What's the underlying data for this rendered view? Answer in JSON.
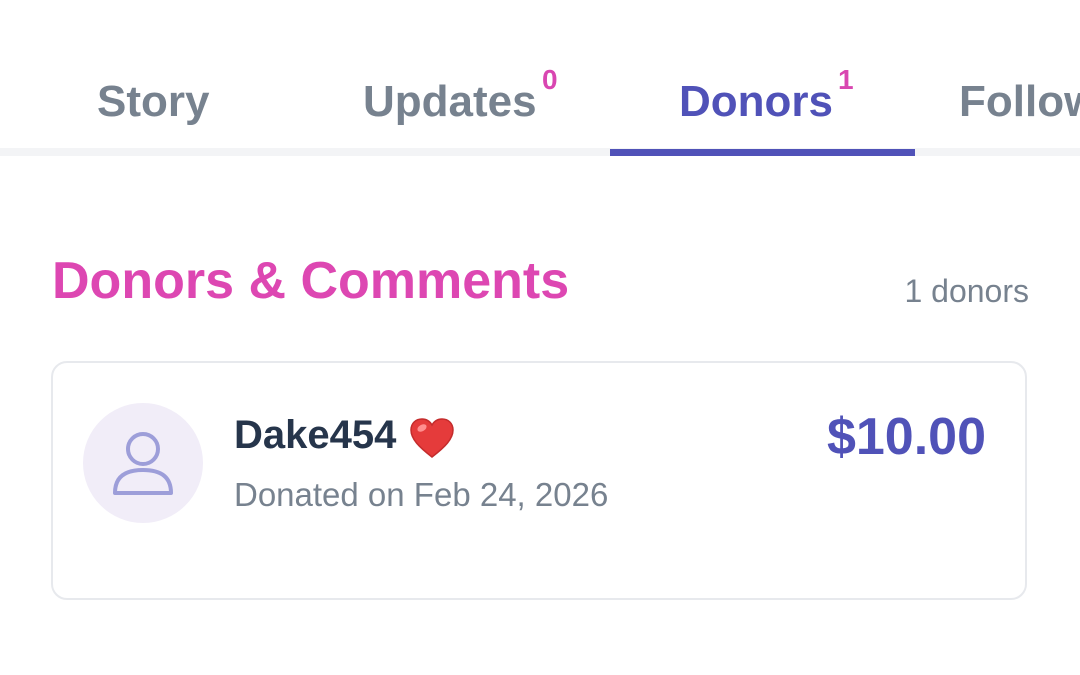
{
  "tabs": [
    {
      "label": "Story",
      "count": "",
      "active": false
    },
    {
      "label": "Updates",
      "count": "0",
      "active": false
    },
    {
      "label": "Donors",
      "count": "1",
      "active": true
    },
    {
      "label": "Followers",
      "count": "",
      "active": false
    }
  ],
  "section": {
    "title": "Donors & Comments",
    "count_text": "1 donors"
  },
  "donors": [
    {
      "name": "Dake454",
      "name_icon": "heart-emoji",
      "date_text": "Donated on Feb 24, 2026",
      "amount": "$10.00",
      "avatar_icon": "user-icon"
    }
  ],
  "colors": {
    "accent": "#5052b8",
    "heading": "#dd47b2",
    "badge": "#d946b1",
    "muted_text": "#77828f",
    "name_text": "#26354b",
    "avatar_bg": "#f1edf8",
    "heart": "#e53b3b"
  }
}
